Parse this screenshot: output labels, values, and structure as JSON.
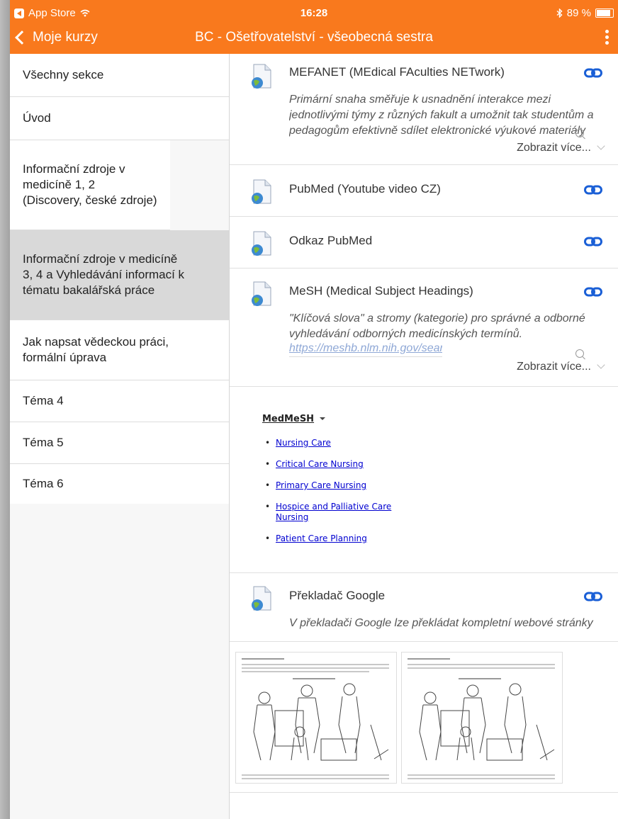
{
  "status_bar": {
    "carrier": "App Store",
    "time": "16:28",
    "battery": "89 %"
  },
  "navbar": {
    "back_label": "Moje kurzy",
    "title": "BC - Ošetřovatelství - všeobecná sestra"
  },
  "sidebar": {
    "items": [
      {
        "label": "Všechny sekce"
      },
      {
        "label": "Úvod"
      },
      {
        "label": "Informační zdroje v medicíně 1, 2 (Discovery, české zdroje)"
      },
      {
        "label": "Informační zdroje v medicíně 3, 4 a Vyhledávání informací k tématu bakalářská práce"
      },
      {
        "label": "Jak napsat vědeckou práci, formální úprava"
      },
      {
        "label": "Téma 4"
      },
      {
        "label": "Téma 5"
      },
      {
        "label": "Téma 6"
      }
    ],
    "active_index": 3
  },
  "resources": [
    {
      "title": "MEFANET (MEdical FAculties NETwork)",
      "description": "Primární snaha směřuje k usnadnění interakce mezi jednotlivými týmy z různých fakult a umožnit tak studentům a pedagogům efektivně sdílet elektronické výukové materiály",
      "show_more": "Zobrazit více..."
    },
    {
      "title": "PubMed (Youtube video CZ)"
    },
    {
      "title": "Odkaz PubMed"
    },
    {
      "title": "MeSH (Medical Subject Headings)",
      "description": "\"Klíčová slova\" a stromy (kategorie) pro správné a odborné vyhledávání odborných medicínských termínů.",
      "link": "https://meshb.nlm.nih.gov/search",
      "show_more": "Zobrazit více..."
    },
    {
      "title": "Překladač Google",
      "description": "V překladači Google lze překládat kompletní webové stránky"
    }
  ],
  "medmesh": {
    "title": "MedMeSH",
    "links": [
      "Nursing Care",
      "Critical Care Nursing",
      "Primary Care Nursing",
      "Hospice and Palliative Care Nursing",
      "Patient Care Planning"
    ]
  },
  "colors": {
    "accent": "#f9791d",
    "link_icon": "#1a5fd6",
    "active_row": "#d9d9d9"
  },
  "icons": [
    "chevron-left-icon",
    "more-vertical-icon",
    "file-globe-icon",
    "link-icon",
    "search-icon",
    "chevron-down-icon",
    "bluetooth-icon",
    "battery-icon",
    "wifi-icon"
  ]
}
